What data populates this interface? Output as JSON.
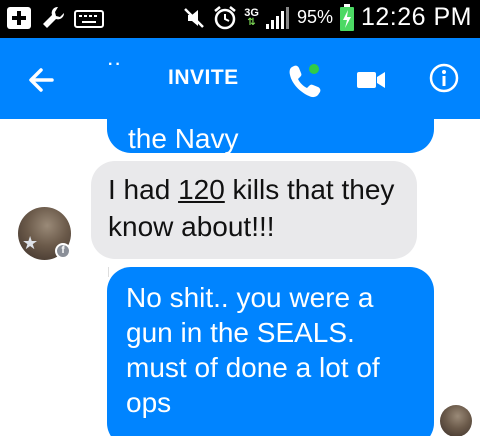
{
  "status_bar": {
    "network_type": "3G",
    "battery_percent": "95%",
    "time": "12:26 PM",
    "icons": [
      "add-icon",
      "wrench-icon",
      "keyboard-icon",
      "mute-icon",
      "alarm-icon",
      "signal-icon",
      "battery-charging-icon"
    ]
  },
  "header": {
    "dots": "··",
    "title": "INVITE",
    "call_status_color": "#31cc46",
    "accent_color": "#0084ff"
  },
  "messages": [
    {
      "direction": "outgoing",
      "text": "the Navy"
    },
    {
      "direction": "incoming",
      "text_before": "I had ",
      "number": "120",
      "text_after": " kills that they know about!!!"
    },
    {
      "direction": "outgoing",
      "text": "No shit.. you were a gun in the SEALS. must of done a lot of ops"
    }
  ],
  "colors": {
    "incoming_bubble": "#e9e9eb",
    "outgoing_bubble": "#0084ff"
  }
}
